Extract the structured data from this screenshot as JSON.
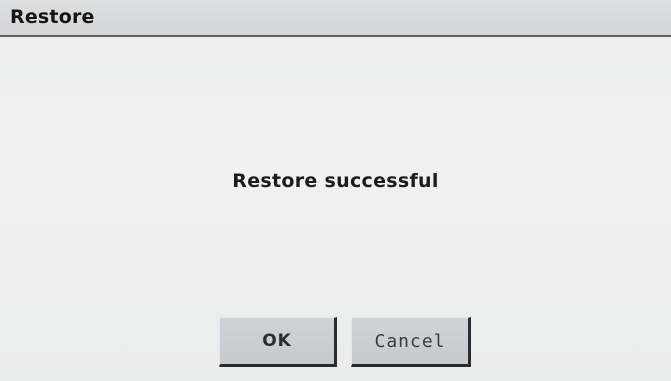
{
  "dialog": {
    "title": "Restore",
    "message": "Restore successful",
    "buttons": {
      "ok_label": "OK",
      "cancel_label": "Cancel"
    }
  },
  "colors": {
    "titlebar": "#d6d8da",
    "titlebar_border": "#5f6163",
    "background": "#eeeeee",
    "button": "#cacfd3",
    "button_shadow": "#2a2c2e",
    "text": "#1b1b1b"
  }
}
